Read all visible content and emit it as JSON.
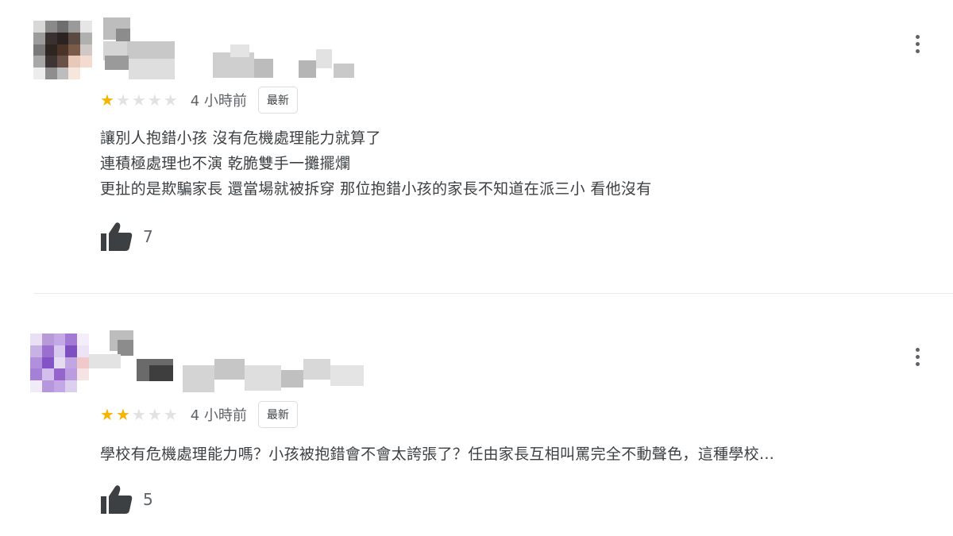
{
  "reviews": [
    {
      "rating": 1,
      "max_rating": 5,
      "time": "4 小時前",
      "tag": "最新",
      "text_lines": [
        "讓別人抱錯小孩 沒有危機處理能力就算了",
        "連積極處理也不演 乾脆雙手一攤擺爛",
        "更扯的是欺騙家長 還當場就被拆穿 那位抱錯小孩的家長不知道在派三小 看他沒有"
      ],
      "likes": "7",
      "avatar_palette": [
        "#8a8a8a",
        "#5a5a5a",
        "#3c2e28",
        "#6b4a3a",
        "#c9c9c9",
        "#f3d7c8"
      ]
    },
    {
      "rating": 2,
      "max_rating": 5,
      "time": "4 小時前",
      "tag": "最新",
      "text_lines": [
        "學校有危機處理能力嗎？小孩被抱錯會不會太誇張了？任由家長互相叫罵完全不動聲色，這種學校…"
      ],
      "likes": "5",
      "avatar_palette": [
        "#b99ad9",
        "#9b6fd0",
        "#7e4fc0",
        "#d6c3ec",
        "#c5a9e6",
        "#f2c9c9"
      ]
    }
  ]
}
